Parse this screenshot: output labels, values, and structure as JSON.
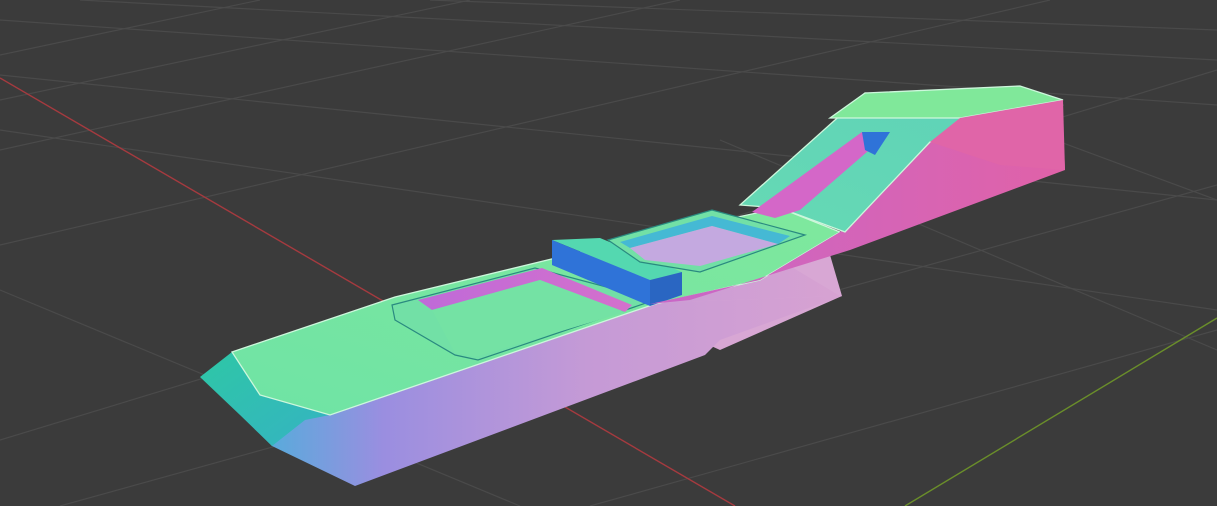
{
  "viewport": {
    "background_color": "#3b3b3b",
    "grid_line_color": "#4a4a4a",
    "x_axis_color": "#a53a3f",
    "y_axis_color": "#6a8e2a"
  },
  "object": {
    "shading": "normal-map",
    "colors": {
      "top_green": "#7de8a0",
      "top_green_dark": "#66d8a6",
      "teal": "#3fb8c6",
      "blue": "#2f73d8",
      "violet": "#9b8ce0",
      "pink": "#dd66b8",
      "pink_light": "#e690c8",
      "edge_highlight": "#cdf7dc"
    }
  }
}
